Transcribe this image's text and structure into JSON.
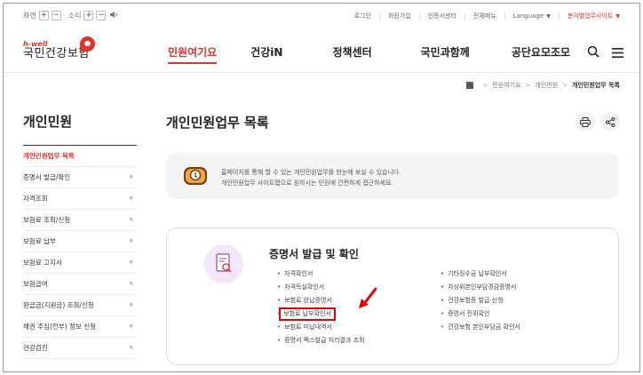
{
  "utility": {
    "zoom_label": "화면",
    "zoom_plus": "+",
    "zoom_minus": "−",
    "sound_label": "소리",
    "sound_plus": "+",
    "sound_minus": "−",
    "links": [
      "로그인",
      "회원가입",
      "인증서센터",
      "전체메뉴",
      "Language"
    ],
    "related_sites": "분야별업무사이트"
  },
  "header": {
    "logo_brand": "h-well",
    "logo_name": "국민건강보험",
    "nav": [
      "민원여기요",
      "건강iN",
      "정책센터",
      "국민과함께",
      "공단요모조모"
    ],
    "active_nav": "민원여기요"
  },
  "breadcrumb": [
    "민원여기요",
    "개인민원",
    "개인민원업무 목록"
  ],
  "sidebar": {
    "title": "개인민원",
    "items": [
      {
        "label": "개인민원업무 목록",
        "active": true
      },
      {
        "label": "증명서 발급/확인",
        "active": false
      },
      {
        "label": "자격조회",
        "active": false
      },
      {
        "label": "보험료 조회/신청",
        "active": false
      },
      {
        "label": "보험료 납부",
        "active": false
      },
      {
        "label": "보험료 고지서",
        "active": false
      },
      {
        "label": "보험급여",
        "active": false
      },
      {
        "label": "환급금(지원금) 조회/신청",
        "active": false
      },
      {
        "label": "채권 추심(전부) 정보 신청",
        "active": false
      },
      {
        "label": "건강검진",
        "active": false
      }
    ]
  },
  "content": {
    "title": "개인민원업무 목록",
    "info_line1": "홈페이지를 통해 할 수 있는 개인민원업무를 한눈에 보실 수 있습니다.",
    "info_line2": "개인민원업무 사이트맵으로 원하시는 민원에 간편하게 접근하세요.",
    "card_title": "증명서 발급 및 확인",
    "col1": [
      "자격확인서",
      "자격득실확인서",
      "보험료 완납증명서",
      "보험료 납부확인서",
      "보험료 미납내역서",
      "증명서 팩스발급 처리결과 조회"
    ],
    "col2": [
      "기타징수금 납부확인서",
      "차상위본인부담경감증명서",
      "건강보험증 발급 신청",
      "증명서 진위확인",
      "건강보험 본인부담금 확인서"
    ],
    "highlighted_item": "보험료 납부확인서"
  },
  "colors": {
    "accent": "#e0322e",
    "highlight_box": "#ee0000"
  }
}
